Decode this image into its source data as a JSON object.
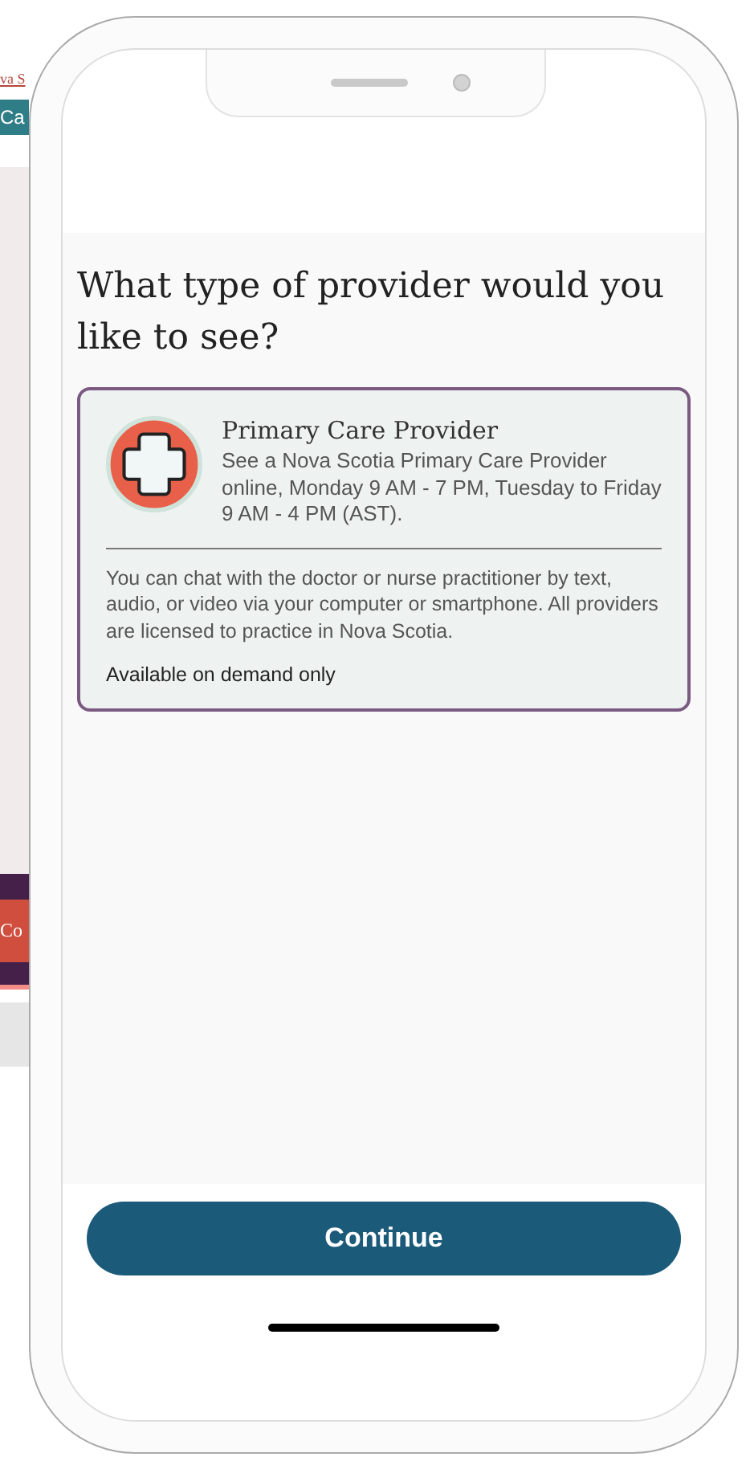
{
  "background_page": {
    "link": "va S",
    "top_button": "Ca",
    "bottom_button": "Co"
  },
  "screen": {
    "title": "What type of provider would you like to see?",
    "option": {
      "title": "Primary Care Provider",
      "summary": "See a Nova Scotia Primary Care Provider online, Monday 9 AM - 7 PM, Tuesday to Friday 9 AM - 4 PM (AST).",
      "description": "You can chat with the doctor or nurse practitioner by text, audio, or video via your computer or smartphone. All providers are licensed to practice in Nova Scotia.",
      "availability": "Available on demand only"
    },
    "continue_button": "Continue"
  }
}
